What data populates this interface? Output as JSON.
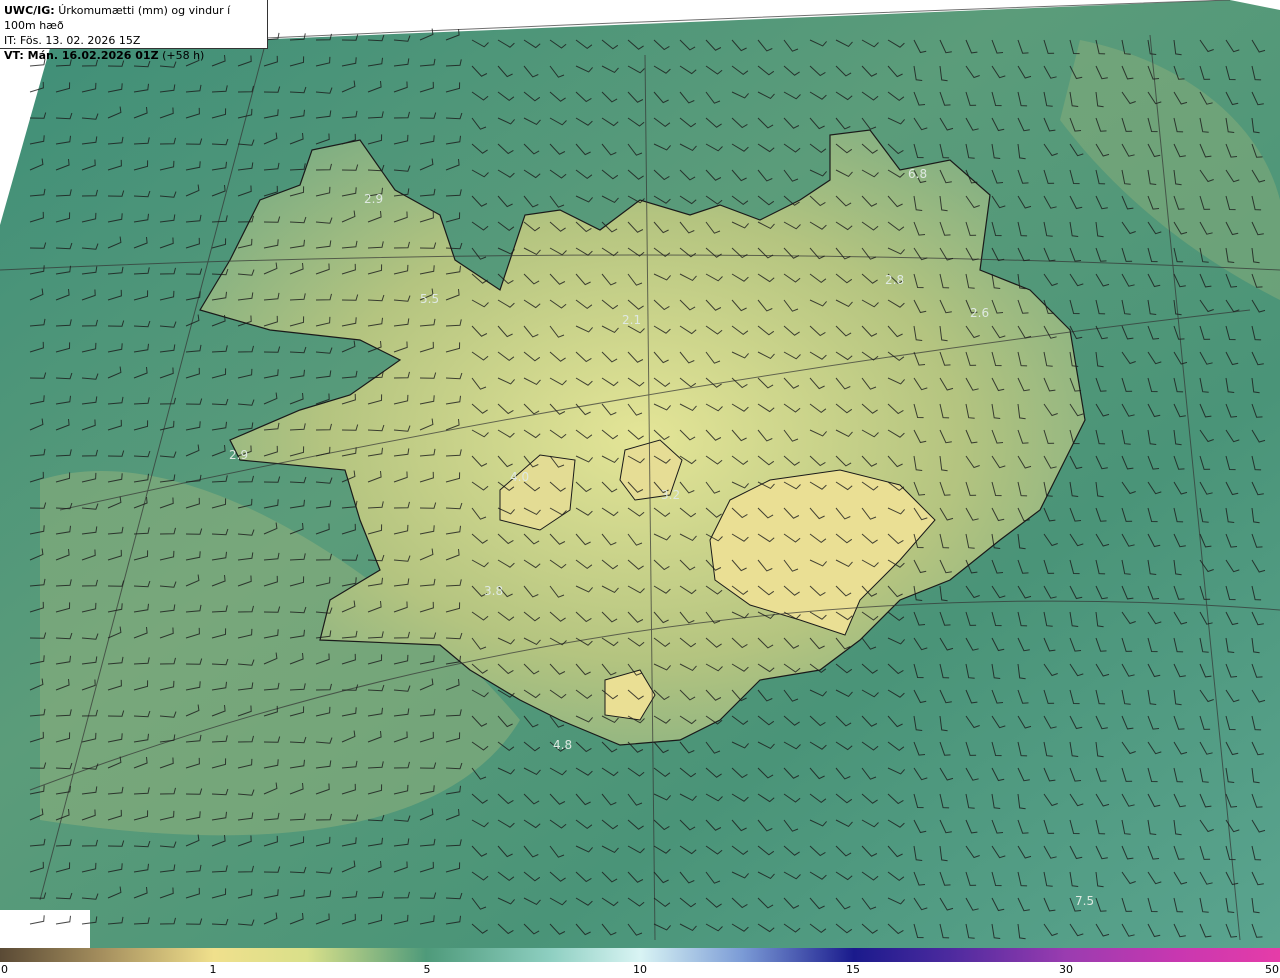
{
  "header": {
    "line1_bold": "UWC/IG:",
    "line1_rest": "Úrkomumætti (mm) og vindur í 100m hæð",
    "line2": "IT: Fös. 13. 02. 2026 15Z",
    "line3_bold": "VT: Mán. 16.02.2026 01Z",
    "line3_rest": "(+58 h)"
  },
  "map_labels": [
    {
      "id": "label-1",
      "text": "2.9"
    },
    {
      "id": "label-2",
      "text": "5.5"
    },
    {
      "id": "label-3",
      "text": "2.1"
    },
    {
      "id": "label-4",
      "text": "6.8"
    },
    {
      "id": "label-5",
      "text": "2.8"
    },
    {
      "id": "label-6",
      "text": "2.6"
    },
    {
      "id": "label-7",
      "text": "2.9"
    },
    {
      "id": "label-8",
      "text": "4.0"
    },
    {
      "id": "label-9",
      "text": "3.2"
    },
    {
      "id": "label-10",
      "text": "3.8"
    },
    {
      "id": "label-11",
      "text": "4.8"
    },
    {
      "id": "label-12",
      "text": "7.5"
    }
  ],
  "colorbar": {
    "ticks": [
      "0",
      "1",
      "5",
      "10",
      "15",
      "30",
      "50"
    ]
  },
  "colors": {
    "sea": "#3f8a6e",
    "land": "#c8cf86",
    "coast": "#1a1a1a"
  }
}
